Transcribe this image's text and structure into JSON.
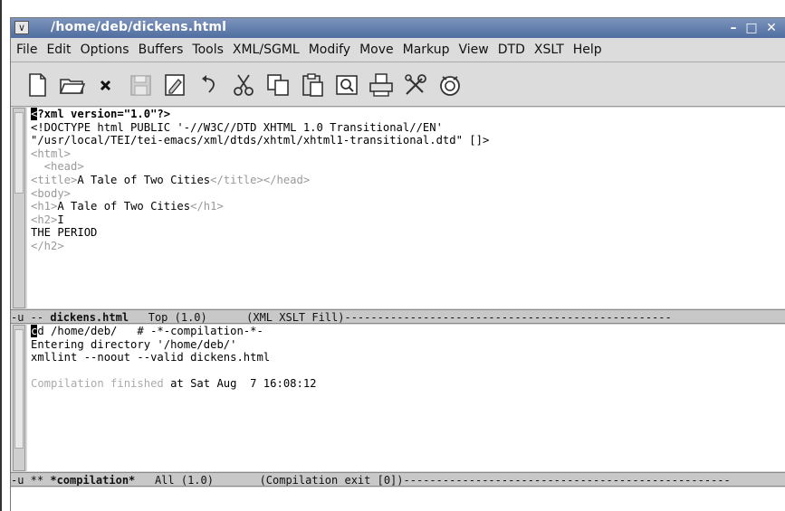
{
  "window": {
    "title": "/home/deb/dickens.html",
    "menu_glyph": "∨",
    "minimize": "–",
    "maximize": "□",
    "close": "✕"
  },
  "menubar": {
    "items": [
      "File",
      "Edit",
      "Options",
      "Buffers",
      "Tools",
      "XML/SGML",
      "Modify",
      "Move",
      "Markup",
      "View",
      "DTD",
      "XSLT",
      "Help"
    ]
  },
  "toolbar": {
    "icons": [
      "new-file-icon",
      "open-folder-icon",
      "close-icon",
      "save-icon",
      "save-as-icon",
      "undo-icon",
      "cut-icon",
      "copy-icon",
      "paste-icon",
      "search-icon",
      "print-icon",
      "customize-icon",
      "help-icon"
    ]
  },
  "editor": {
    "cursor_char": "<",
    "line1_rest": "?xml version=\"1.0\"?>",
    "line2": "<!DOCTYPE html PUBLIC '-//W3C//DTD XHTML 1.0 Transitional//EN'",
    "line3": "\"/usr/local/TEI/tei-emacs/xml/dtds/xhtml/xhtml1-transitional.dtd\" []>",
    "line4": "<html>",
    "line5": "  <head>",
    "line6_open": "<title>",
    "line6_text": "A Tale of Two Cities",
    "line6_close": "</title></head>",
    "line7": "<body>",
    "line8_open": "<h1>",
    "line8_text": "A Tale of Two Cities",
    "line8_close": "</h1>",
    "line9_open": "<h2>",
    "line9_text": "I",
    "line10": "THE PERIOD",
    "line11": "</h2>"
  },
  "modeline1": {
    "prefix": "-u -- ",
    "buffer": "dickens.html",
    "position": "   Top (1.0)     ",
    "modes": " (XML XSLT Fill)",
    "fill": "--------------------------------------------------"
  },
  "compilation": {
    "cursor_char": "c",
    "line1_rest": "d /home/deb/   # -*-compilation-*-",
    "line2": "Entering directory '/home/deb/'",
    "line3": "xmllint --noout --valid dickens.html",
    "line5_dim": "Compilation finished",
    "line5_rest": " at Sat Aug  7 16:08:12"
  },
  "modeline2": {
    "prefix": "-u ** ",
    "buffer": "*compilation*",
    "position": "   All (1.0)       ",
    "modes": "(Compilation exit [0])",
    "fill": "--------------------------------------------------"
  }
}
